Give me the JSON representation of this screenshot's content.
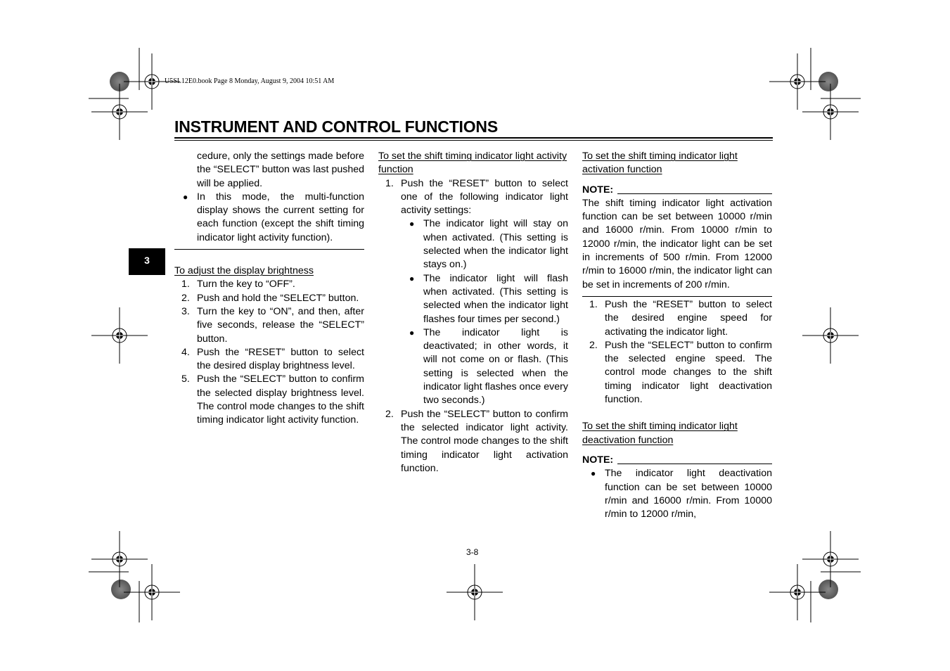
{
  "print_header": "U5SL12E0.book  Page 8  Monday, August 9, 2004  10:51 AM",
  "title": "INSTRUMENT AND CONTROL FUNCTIONS",
  "chapter_tab": "3",
  "page_number": "3-8",
  "col1": {
    "continued_text": "cedure, only the settings made before the “SELECT” button was last pushed will be applied.",
    "bullet": "In this mode, the multi-function display shows the current setting for each function (except the shift timing indicator light activity function).",
    "heading": "To adjust the display brightness",
    "steps": [
      "Turn the key to “OFF”.",
      "Push and hold the “SELECT” button.",
      "Turn the key to “ON”, and then, after five seconds, release the “SELECT” button.",
      "Push the “RESET” button to select the desired display brightness level.",
      "Push the “SELECT” button to confirm the selected display brightness level. The control mode changes to the shift timing indicator light activity function."
    ]
  },
  "col2": {
    "heading": "To set the shift timing indicator light activity function",
    "step1": "Push the “RESET” button to select one of the following indicator light activity settings:",
    "options": [
      "The indicator light will stay on when activated. (This setting is selected when the indicator light stays on.)",
      "The indicator light will flash when activated. (This setting is selected when the indicator light flashes four times per second.)",
      "The indicator light is deactivated; in other words, it will not come on or flash. (This setting is selected when the indicator light flashes once every two seconds.)"
    ],
    "step2": "Push the “SELECT” button to confirm the selected indicator light activity. The control mode changes to the shift timing indicator light activation function."
  },
  "col3": {
    "heading1": "To set the shift timing indicator light activation function",
    "note_label": "NOTE:",
    "note1": "The shift timing indicator light activation function can be set between 10000 r/min and 16000 r/min. From 10000 r/min to 12000 r/min, the indicator light can be set in increments of 500 r/min. From 12000 r/min to 16000 r/min, the indicator light can be set in increments of 200 r/min.",
    "steps": [
      "Push the “RESET” button to select the desired engine speed for activating the indicator light.",
      "Push the “SELECT” button to confirm the selected engine speed. The control mode changes to the shift timing indicator light deactivation function."
    ],
    "heading2": "To set the shift timing indicator light deactivation function",
    "note2_bullet": "The indicator light deactivation function can be set between 10000 r/min and 16000 r/min. From 10000 r/min to 12000 r/min,"
  }
}
